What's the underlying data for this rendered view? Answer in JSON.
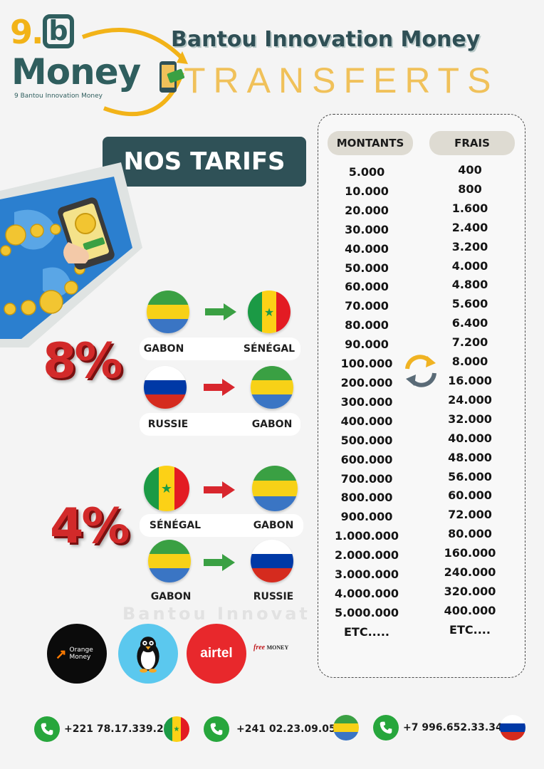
{
  "logo": {
    "mark": "9.b",
    "wordmark": "Money",
    "tagline": "9 Bantou Innovation Money"
  },
  "header": {
    "title": "Bantou Innovation Money",
    "subtitle": "TRANSFERTS"
  },
  "section_title": "NOS TARIFS",
  "watermark": "Bantou Innovat",
  "rate_groups": [
    {
      "rate": "8%",
      "routes": [
        {
          "from": "GABON",
          "to": "SÉNÉGAL",
          "arrow_color": "#3aa043"
        },
        {
          "from": "RUSSIE",
          "to": "GABON",
          "arrow_color": "#d8262d"
        }
      ]
    },
    {
      "rate": "4%",
      "routes": [
        {
          "from": "SÉNÉGAL",
          "to": "GABON",
          "arrow_color": "#d8262d"
        },
        {
          "from": "GABON",
          "to": "RUSSIE",
          "arrow_color": "#3aa043"
        }
      ]
    }
  ],
  "pricing": {
    "header_amounts": "MONTANTS",
    "header_fees": "FRAIS",
    "amounts": [
      "5.000",
      "10.000",
      "20.000",
      "30.000",
      "40.000",
      "50.000",
      "60.000",
      "70.000",
      "80.000",
      "90.000",
      "100.000",
      "200.000",
      "300.000",
      "400.000",
      "500.000",
      "600.000",
      "700.000",
      "800.000",
      "900.000",
      "1.000.000",
      "2.000.000",
      "3.000.000",
      "4.000.000",
      "5.000.000",
      "ETC....."
    ],
    "fees": [
      "400",
      "800",
      "1.600",
      "2.400",
      "3.200",
      "4.000",
      "4.800",
      "5.600",
      "6.400",
      "7.200",
      "8.000",
      "16.000",
      "24.000",
      "32.000",
      "40.000",
      "48.000",
      "56.000",
      "60.000",
      "72.000",
      "80.000",
      "160.000",
      "240.000",
      "320.000",
      "400.000",
      "ETC...."
    ]
  },
  "payment_methods": {
    "orange": "Orange Money",
    "airtel": "airtel",
    "free_money_a": "free",
    "free_money_b": "MONEY"
  },
  "contacts": [
    {
      "phone": "+221 78.17.339.27",
      "flag": "senegal"
    },
    {
      "phone": "+241 02.23.09.05",
      "flag": "gabon"
    },
    {
      "phone": "+7 996.652.33.34",
      "flag": "russia"
    }
  ],
  "colors": {
    "brand_dark": "#2f5157",
    "brand_gold": "#f0c15a",
    "rate_red": "#d22a2a",
    "gabon_green": "#3aa043",
    "gabon_yellow": "#f7d117",
    "gabon_blue": "#3a75c4",
    "senegal_green": "#1b9a45",
    "senegal_yellow": "#fcd116",
    "senegal_red": "#e31b23",
    "russia_white": "#ffffff",
    "russia_blue": "#0039a6",
    "russia_red": "#d52b1e"
  }
}
